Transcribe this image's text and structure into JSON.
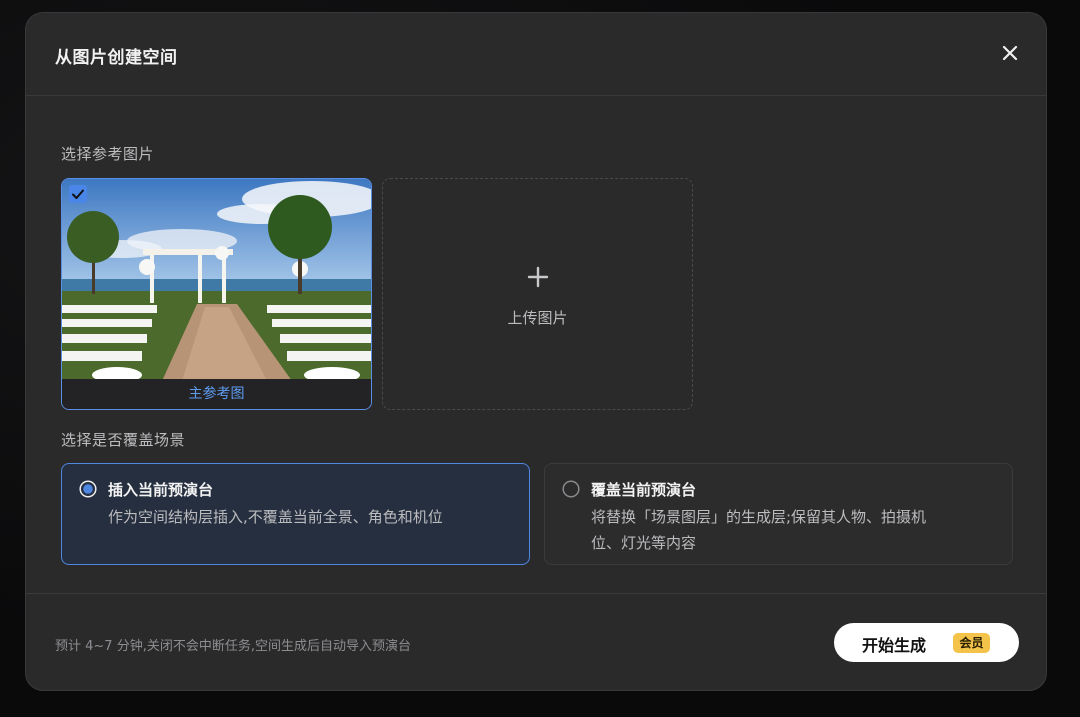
{
  "dialog": {
    "title": "从图片创建空间",
    "close_icon": "close-icon"
  },
  "reference": {
    "section_label": "选择参考图片",
    "main_caption": "主参考图",
    "selected": true,
    "upload_label": "上传图片",
    "upload_icon": "plus-icon"
  },
  "overwrite": {
    "section_label": "选择是否覆盖场景",
    "options": [
      {
        "title": "插入当前预演台",
        "desc": "作为空间结构层插入,不覆盖当前全景、角色和机位",
        "selected": true
      },
      {
        "title": "覆盖当前预演台",
        "desc_line1": "将替换「场景图层」的生成层;保留其人物、拍摄机",
        "desc_line2": "位、灯光等内容",
        "selected": false
      }
    ]
  },
  "footer": {
    "note": "预计 4~7 分钟,关闭不会中断任务,空间生成后自动导入预演台",
    "start_label": "开始生成",
    "vip_badge": "会员"
  },
  "colors": {
    "accent": "#4f86e0",
    "dialog_bg": "#2a2a2b",
    "badge": "#f3c34a"
  }
}
